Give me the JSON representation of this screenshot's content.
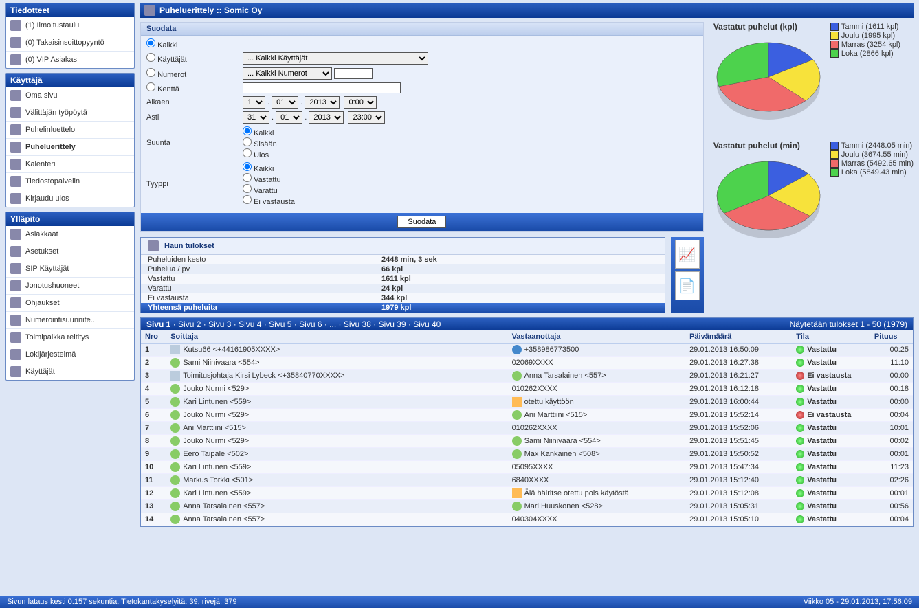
{
  "header": {
    "title": "Puheluerittely :: Somic Oy"
  },
  "sidebar": {
    "tiedotteet": {
      "title": "Tiedotteet",
      "items": [
        {
          "label": "(1) Ilmoitustaulu"
        },
        {
          "label": "(0) Takaisinsoittopyyntö"
        },
        {
          "label": "(0) VIP Asiakas"
        }
      ]
    },
    "kayttaja": {
      "title": "Käyttäjä",
      "items": [
        {
          "label": "Oma sivu"
        },
        {
          "label": "Välittäjän työpöytä"
        },
        {
          "label": "Puhelinluettelo"
        },
        {
          "label": "Puheluerittely",
          "active": true
        },
        {
          "label": "Kalenteri"
        },
        {
          "label": "Tiedostopalvelin"
        },
        {
          "label": "Kirjaudu ulos"
        }
      ]
    },
    "yllapito": {
      "title": "Ylläpito",
      "items": [
        {
          "label": "Asiakkaat"
        },
        {
          "label": "Asetukset"
        },
        {
          "label": "SIP Käyttäjät"
        },
        {
          "label": "Jonotushuoneet"
        },
        {
          "label": "Ohjaukset"
        },
        {
          "label": "Numerointisuunnite.."
        },
        {
          "label": "Toimipaikka reititys"
        },
        {
          "label": "Lokijärjestelmä"
        },
        {
          "label": "Käyttäjät"
        }
      ]
    }
  },
  "filter": {
    "title": "Suodata",
    "kaikki": "Kaikki",
    "kayttajat": "Käyttäjät",
    "kayttajat_sel": "... Kaikki Käyttäjät",
    "numerot": "Numerot",
    "numerot_sel": "... Kaikki Numerot",
    "kentta": "Kenttä",
    "alkaen": "Alkaen",
    "alkaen_day": "1",
    "alkaen_month": "01",
    "alkaen_year": "2013",
    "alkaen_time": "0:00",
    "asti": "Asti",
    "asti_day": "31",
    "asti_month": "01",
    "asti_year": "2013",
    "asti_time": "23:00",
    "suunta": "Suunta",
    "suunta_kaikki": "Kaikki",
    "suunta_sisaan": "Sisään",
    "suunta_ulos": "Ulos",
    "tyyppi": "Tyyppi",
    "tyyppi_kaikki": "Kaikki",
    "tyyppi_vastattu": "Vastattu",
    "tyyppi_varattu": "Varattu",
    "tyyppi_eivast": "Ei vastausta",
    "btn": "Suodata"
  },
  "results": {
    "title": "Haun tulokset",
    "rows": [
      {
        "k": "Puheluiden kesto",
        "v": "2448 min, 3 sek"
      },
      {
        "k": "Puhelua / pv",
        "v": "66 kpl"
      },
      {
        "k": "Vastattu",
        "v": "1611 kpl"
      },
      {
        "k": "Varattu",
        "v": "24 kpl"
      },
      {
        "k": "Ei vastausta",
        "v": "344 kpl"
      }
    ],
    "total_k": "Yhteensä puheluita",
    "total_v": "1979 kpl"
  },
  "pager": {
    "pages": [
      "Sivu 1",
      "Sivu 2",
      "Sivu 3",
      "Sivu 4",
      "Sivu 5",
      "Sivu 6",
      "...",
      "Sivu 38",
      "Sivu 39",
      "Sivu 40"
    ],
    "right": "Näytetään tulokset 1 - 50 (1979)"
  },
  "table": {
    "headers": {
      "nro": "Nro",
      "soittaja": "Soittaja",
      "vast": "Vastaanottaja",
      "pvm": "Päivämäärä",
      "tila": "Tila",
      "pituus": "Pituus"
    },
    "rows": [
      {
        "n": "1",
        "ci": "doc",
        "c": "Kutsu66 <+44161905XXXX>",
        "ri": "globe",
        "r": "+358986773500",
        "d": "29.01.2013 16:50:09",
        "s": "Vastattu",
        "sc": "green",
        "l": "00:25"
      },
      {
        "n": "2",
        "ci": "user",
        "c": "Sami Niinivaara <554>",
        "ri": "",
        "r": "02069XXXX",
        "d": "29.01.2013 16:27:38",
        "s": "Vastattu",
        "sc": "green",
        "l": "11:10"
      },
      {
        "n": "3",
        "ci": "doc",
        "c": "Toimitusjohtaja Kirsi Lybeck <+35840770XXXX>",
        "ri": "user",
        "r": "Anna Tarsalainen <557>",
        "d": "29.01.2013 16:21:27",
        "s": "Ei vastausta",
        "sc": "red",
        "l": "00:00"
      },
      {
        "n": "4",
        "ci": "user",
        "c": "Jouko Nurmi <529>",
        "ri": "",
        "r": "010262XXXX",
        "d": "29.01.2013 16:12:18",
        "s": "Vastattu",
        "sc": "green",
        "l": "00:18"
      },
      {
        "n": "5",
        "ci": "user",
        "c": "Kari Lintunen <559>",
        "ri": "warn",
        "r": "otettu käyttöön",
        "d": "29.01.2013 16:00:44",
        "s": "Vastattu",
        "sc": "green",
        "l": "00:00"
      },
      {
        "n": "6",
        "ci": "user",
        "c": "Jouko Nurmi <529>",
        "ri": "user",
        "r": "Ani Marttiini <515>",
        "d": "29.01.2013 15:52:14",
        "s": "Ei vastausta",
        "sc": "red",
        "l": "00:04"
      },
      {
        "n": "7",
        "ci": "user",
        "c": "Ani Marttiini <515>",
        "ri": "",
        "r": "010262XXXX",
        "d": "29.01.2013 15:52:06",
        "s": "Vastattu",
        "sc": "green",
        "l": "10:01"
      },
      {
        "n": "8",
        "ci": "user",
        "c": "Jouko Nurmi <529>",
        "ri": "user",
        "r": "Sami Niinivaara <554>",
        "d": "29.01.2013 15:51:45",
        "s": "Vastattu",
        "sc": "green",
        "l": "00:02"
      },
      {
        "n": "9",
        "ci": "user",
        "c": "Eero Taipale <502>",
        "ri": "user",
        "r": "Max Kankainen <508>",
        "d": "29.01.2013 15:50:52",
        "s": "Vastattu",
        "sc": "green",
        "l": "00:01"
      },
      {
        "n": "10",
        "ci": "user",
        "c": "Kari Lintunen <559>",
        "ri": "",
        "r": "05095XXXX",
        "d": "29.01.2013 15:47:34",
        "s": "Vastattu",
        "sc": "green",
        "l": "11:23"
      },
      {
        "n": "11",
        "ci": "user",
        "c": "Markus Torkki <501>",
        "ri": "",
        "r": "6840XXXX",
        "d": "29.01.2013 15:12:40",
        "s": "Vastattu",
        "sc": "green",
        "l": "02:26"
      },
      {
        "n": "12",
        "ci": "user",
        "c": "Kari Lintunen <559>",
        "ri": "warn",
        "r": "Älä häiritse otettu pois käytöstä",
        "d": "29.01.2013 15:12:08",
        "s": "Vastattu",
        "sc": "green",
        "l": "00:01"
      },
      {
        "n": "13",
        "ci": "user",
        "c": "Anna Tarsalainen <557>",
        "ri": "user",
        "r": "Mari Huuskonen <528>",
        "d": "29.01.2013 15:05:31",
        "s": "Vastattu",
        "sc": "green",
        "l": "00:56"
      },
      {
        "n": "14",
        "ci": "user",
        "c": "Anna Tarsalainen <557>",
        "ri": "",
        "r": "040304XXXX",
        "d": "29.01.2013 15:05:10",
        "s": "Vastattu",
        "sc": "green",
        "l": "00:04"
      }
    ]
  },
  "footer": {
    "left": "Sivun lataus kesti 0.157 sekuntia. Tietokantakyselyitä: 39, rivejä: 379",
    "right": "Viikko 05 - 29.01.2013, 17:56:09"
  },
  "chart_data": [
    {
      "type": "pie",
      "title": "Vastatut puhelut (kpl)",
      "series": [
        {
          "name": "kpl",
          "values": [
            1611,
            1995,
            3254,
            2866
          ]
        }
      ],
      "categories": [
        "Tammi",
        "Joulu",
        "Marras",
        "Loka"
      ],
      "colors": [
        "#3b5fe0",
        "#f7e23b",
        "#f06a6a",
        "#4dd24d"
      ],
      "legend_labels": [
        "Tammi (1611 kpl)",
        "Joulu (1995 kpl)",
        "Marras (3254 kpl)",
        "Loka (2866 kpl)"
      ]
    },
    {
      "type": "pie",
      "title": "Vastatut puhelut (min)",
      "series": [
        {
          "name": "min",
          "values": [
            2448.05,
            3674.55,
            5492.65,
            5849.43
          ]
        }
      ],
      "categories": [
        "Tammi",
        "Joulu",
        "Marras",
        "Loka"
      ],
      "colors": [
        "#3b5fe0",
        "#f7e23b",
        "#f06a6a",
        "#4dd24d"
      ],
      "legend_labels": [
        "Tammi (2448.05 min)",
        "Joulu (3674.55 min)",
        "Marras (5492.65 min)",
        "Loka (5849.43 min)"
      ]
    }
  ]
}
